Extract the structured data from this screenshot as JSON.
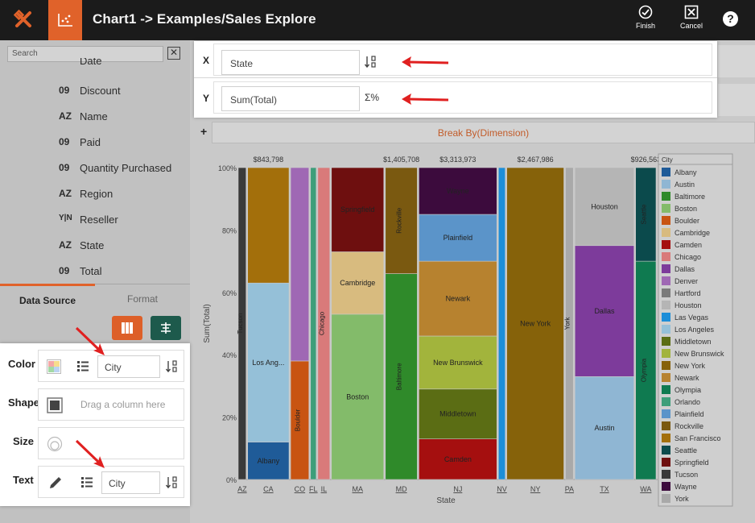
{
  "header": {
    "title": "Chart1 -> Examples/Sales Explore",
    "finish_label": "Finish",
    "cancel_label": "Cancel",
    "help_label": "?"
  },
  "sidebar": {
    "search_placeholder": "Search",
    "clear_label": "✕",
    "fields": [
      {
        "type": "",
        "name": "Date"
      },
      {
        "type": "09",
        "name": "Discount"
      },
      {
        "type": "AZ",
        "name": "Name"
      },
      {
        "type": "09",
        "name": "Paid"
      },
      {
        "type": "09",
        "name": "Quantity Purchased"
      },
      {
        "type": "AZ",
        "name": "Region"
      },
      {
        "type": "Y|N",
        "name": "Reseller"
      },
      {
        "type": "AZ",
        "name": "State"
      },
      {
        "type": "09",
        "name": "Total"
      }
    ],
    "tab_data_source": "Data Source",
    "tab_format": "Format"
  },
  "bindings": {
    "color_label": "Color",
    "color_field": "City",
    "shape_label": "Shape",
    "shape_hint": "Drag a column here",
    "size_label": "Size",
    "text_label": "Text",
    "text_field": "City"
  },
  "axes": {
    "x_label": "X",
    "x_field": "State",
    "y_label": "Y",
    "y_field": "Sum(Total)",
    "agg_symbol": "Σ%"
  },
  "breakby_label": "Break By(Dimension)",
  "plus_label": "+",
  "colors": {
    "accent": "#e0622a",
    "header_bg": "#1b1b1b",
    "arrow": "#e02020"
  },
  "chart_data": {
    "type": "bar",
    "subtype": "stacked-percent-mekko",
    "xlabel": "State",
    "ylabel": "Sum(Total)",
    "yticks": [
      "0%",
      "20%",
      "40%",
      "60%",
      "80%",
      "100%"
    ],
    "legend_title": "City",
    "legend_placement": "right",
    "legend": [
      {
        "name": "Albany",
        "color": "#1f5b98"
      },
      {
        "name": "Austin",
        "color": "#8fb6d3"
      },
      {
        "name": "Baltimore",
        "color": "#2f8a2a"
      },
      {
        "name": "Boston",
        "color": "#83bb6a"
      },
      {
        "name": "Boulder",
        "color": "#c85412"
      },
      {
        "name": "Cambridge",
        "color": "#d8bb7f"
      },
      {
        "name": "Camden",
        "color": "#a50f0f"
      },
      {
        "name": "Chicago",
        "color": "#d97a7a"
      },
      {
        "name": "Dallas",
        "color": "#7d3b9b"
      },
      {
        "name": "Denver",
        "color": "#9f68b4"
      },
      {
        "name": "Hartford",
        "color": "#7b7b7b"
      },
      {
        "name": "Houston",
        "color": "#b5b5b5"
      },
      {
        "name": "Las Vegas",
        "color": "#1d8ed8"
      },
      {
        "name": "Los Angeles",
        "color": "#95c0d8"
      },
      {
        "name": "Middletown",
        "color": "#5b6d14"
      },
      {
        "name": "New Brunswick",
        "color": "#a2b43c"
      },
      {
        "name": "New York",
        "color": "#86620a"
      },
      {
        "name": "Newark",
        "color": "#b7822f"
      },
      {
        "name": "Olympia",
        "color": "#0f7a50"
      },
      {
        "name": "Orlando",
        "color": "#3d9e7a"
      },
      {
        "name": "Plainfield",
        "color": "#5b94c9"
      },
      {
        "name": "Rockville",
        "color": "#7a5910"
      },
      {
        "name": "San Francisco",
        "color": "#a36f0b"
      },
      {
        "name": "Seattle",
        "color": "#0b4a4c"
      },
      {
        "name": "Springfield",
        "color": "#6e0f0f"
      },
      {
        "name": "Tucson",
        "color": "#3a3a3a"
      },
      {
        "name": "Wayne",
        "color": "#3c0b3d"
      },
      {
        "name": "York",
        "color": "#a9a9a9"
      }
    ],
    "states": [
      {
        "state": "AZ",
        "width": 0.018,
        "total_label": "",
        "segments": [
          {
            "city": "Tucson",
            "value": 1.0,
            "label": "Tucson"
          }
        ]
      },
      {
        "state": "CA",
        "width": 0.082,
        "total_label": "$843,798",
        "segments": [
          {
            "city": "Albany",
            "value": 0.12,
            "label": "Albany"
          },
          {
            "city": "Los Angeles",
            "value": 0.51,
            "label": "Los Ang..."
          },
          {
            "city": "San Francisco",
            "value": 0.37,
            "label": ""
          }
        ]
      },
      {
        "state": "CO",
        "width": 0.038,
        "total_label": "",
        "segments": [
          {
            "city": "Boulder",
            "value": 0.38,
            "label": "Boulder"
          },
          {
            "city": "Denver",
            "value": 0.62,
            "label": ""
          }
        ]
      },
      {
        "state": "FL",
        "width": 0.014,
        "total_label": "",
        "segments": [
          {
            "city": "Orlando",
            "value": 1.0,
            "label": ""
          }
        ]
      },
      {
        "state": "IL",
        "width": 0.026,
        "total_label": "",
        "segments": [
          {
            "city": "Chicago",
            "value": 1.0,
            "label": "Chicago"
          }
        ]
      },
      {
        "state": "MA",
        "width": 0.103,
        "total_label": "",
        "segments": [
          {
            "city": "Boston",
            "value": 0.53,
            "label": "Boston"
          },
          {
            "city": "Cambridge",
            "value": 0.2,
            "label": "Cambridge"
          },
          {
            "city": "Springfield",
            "value": 0.27,
            "label": "Springfield"
          }
        ]
      },
      {
        "state": "MD",
        "width": 0.064,
        "total_label": "$1,405,708",
        "segments": [
          {
            "city": "Baltimore",
            "value": 0.66,
            "label": "Baltimore"
          },
          {
            "city": "Rockville",
            "value": 0.34,
            "label": "Rockville"
          }
        ]
      },
      {
        "state": "NJ",
        "width": 0.152,
        "total_label": "$3,313,973",
        "segments": [
          {
            "city": "Camden",
            "value": 0.13,
            "label": "Camden"
          },
          {
            "city": "Middletown",
            "value": 0.16,
            "label": "Middletown"
          },
          {
            "city": "New Brunswick",
            "value": 0.17,
            "label": "New Brunswick"
          },
          {
            "city": "Newark",
            "value": 0.24,
            "label": "Newark"
          },
          {
            "city": "Plainfield",
            "value": 0.15,
            "label": "Plainfield"
          },
          {
            "city": "Wayne",
            "value": 0.15,
            "label": "Wayne"
          }
        ]
      },
      {
        "state": "NV",
        "width": 0.016,
        "total_label": "",
        "segments": [
          {
            "city": "Las Vegas",
            "value": 1.0,
            "label": ""
          }
        ]
      },
      {
        "state": "NY",
        "width": 0.112,
        "total_label": "$2,467,986",
        "segments": [
          {
            "city": "New York",
            "value": 1.0,
            "label": "New York"
          }
        ]
      },
      {
        "state": "PA",
        "width": 0.018,
        "total_label": "",
        "segments": [
          {
            "city": "York",
            "value": 1.0,
            "label": "York"
          }
        ]
      },
      {
        "state": "TX",
        "width": 0.116,
        "total_label": "",
        "segments": [
          {
            "city": "Austin",
            "value": 0.33,
            "label": "Austin"
          },
          {
            "city": "Dallas",
            "value": 0.42,
            "label": "Dallas"
          },
          {
            "city": "Houston",
            "value": 0.25,
            "label": "Houston"
          }
        ]
      },
      {
        "state": "WA",
        "width": 0.042,
        "total_label": "$926,563",
        "segments": [
          {
            "city": "Olympia",
            "value": 0.7,
            "label": "Olympia"
          },
          {
            "city": "Seattle",
            "value": 0.3,
            "label": "Seattle"
          }
        ]
      }
    ]
  }
}
